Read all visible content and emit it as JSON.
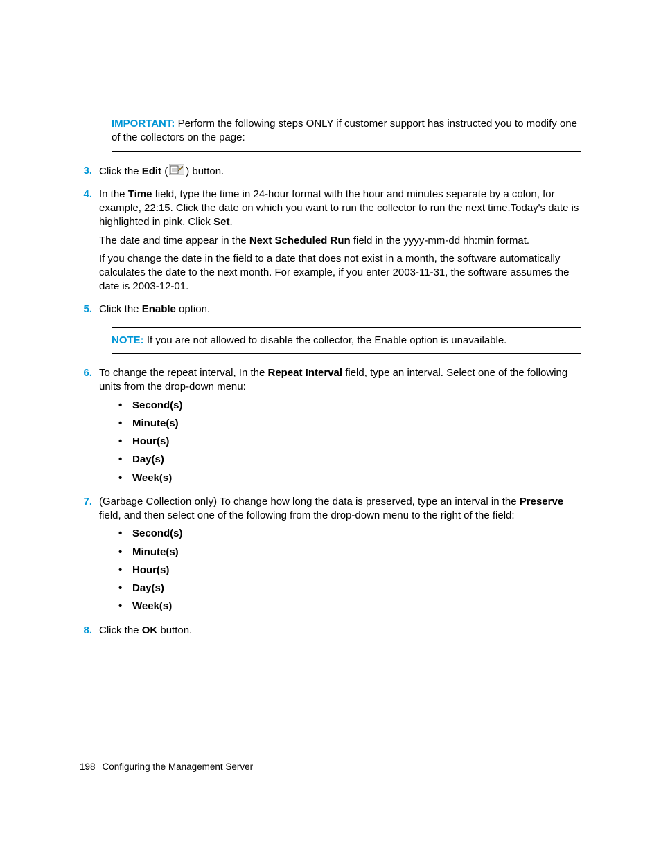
{
  "callout_important": {
    "label": "IMPORTANT:",
    "text": "Perform the following steps ONLY if customer support has instructed you to modify one of the collectors on the page:"
  },
  "steps": {
    "s3": {
      "num": "3.",
      "t1": "Click the ",
      "b1": "Edit",
      "t2": " (",
      "t3": ") button."
    },
    "s4": {
      "num": "4.",
      "p1_t1": "In the ",
      "p1_b1": "Time",
      "p1_t2": " field, type the time in 24-hour format with the hour and minutes separate by a colon, for example, 22:15. Click the date on which you want to run the collector to run the next time.Today's date is highlighted in pink. Click ",
      "p1_b2": "Set",
      "p1_t3": ".",
      "p2_t1": "The date and time appear in the ",
      "p2_b1": "Next Scheduled Run",
      "p2_t2": " field in the yyyy-mm-dd hh:min format.",
      "p3": "If you change the date in the field to a date that does not exist in a month, the software automatically calculates the date to the next month. For example, if you enter 2003-11-31, the software assumes the date is 2003-12-01."
    },
    "s5": {
      "num": "5.",
      "t1": "Click the ",
      "b1": "Enable",
      "t2": " option."
    },
    "s6": {
      "num": "6.",
      "t1": "To change the repeat interval, In the ",
      "b1": "Repeat Interval",
      "t2": " field, type an interval. Select one of the following units from the drop-down menu:",
      "bullets": [
        "Second(s)",
        "Minute(s)",
        "Hour(s)",
        "Day(s)",
        "Week(s)"
      ]
    },
    "s7": {
      "num": "7.",
      "t1": "(Garbage Collection only) To change how long the data is preserved, type an interval in the ",
      "b1": "Preserve",
      "t2": " field, and then select one of the following from the drop-down menu to the right of the field:",
      "bullets": [
        "Second(s)",
        "Minute(s)",
        "Hour(s)",
        "Day(s)",
        "Week(s)"
      ]
    },
    "s8": {
      "num": "8.",
      "t1": "Click the ",
      "b1": "OK",
      "t2": " button."
    }
  },
  "callout_note": {
    "label": "NOTE:",
    "text": "If you are not allowed to disable the collector, the Enable option is unavailable."
  },
  "footer": {
    "page": "198",
    "title": "Configuring the Management Server"
  }
}
